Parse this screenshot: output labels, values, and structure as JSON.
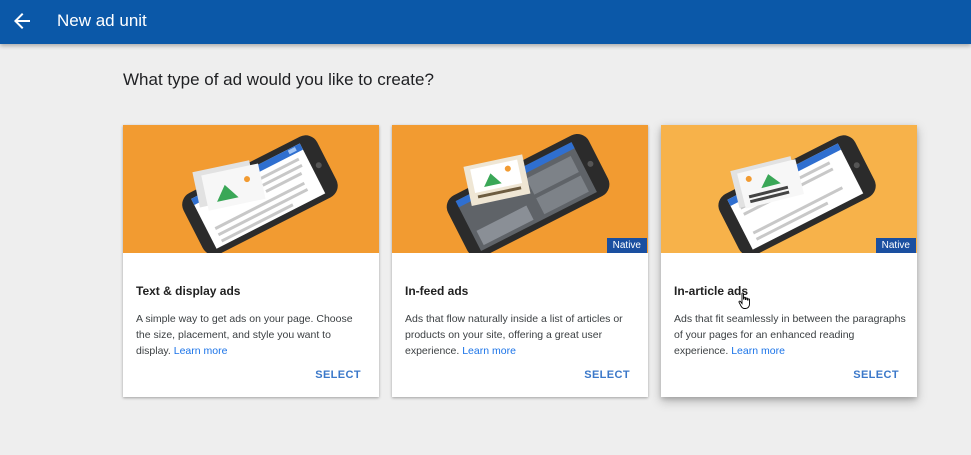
{
  "header": {
    "title": "New ad unit",
    "back_icon": "arrow-back-icon",
    "background": "#0b58a8"
  },
  "main": {
    "heading": "What type of ad would you like to create?"
  },
  "cards": [
    {
      "title": "Text & display ads",
      "description": "A simple way to get ads on your page. Choose the size, placement, and style you want to display.",
      "link": "Learn more",
      "select_label": "SELECT",
      "badge": "",
      "media_color": "#f29b31"
    },
    {
      "title": "In-feed ads",
      "description": "Ads that flow naturally inside a list of articles or products on your site, offering a great user experience.",
      "link": "Learn more",
      "select_label": "SELECT",
      "badge": "Native",
      "media_color": "#f29b31"
    },
    {
      "title": "In-article ads",
      "description": "Ads that fit seamlessly in between the paragraphs of your pages for an enhanced reading experience.",
      "link": "Learn more",
      "select_label": "SELECT",
      "badge": "Native",
      "media_color": "#f7b24a"
    }
  ]
}
